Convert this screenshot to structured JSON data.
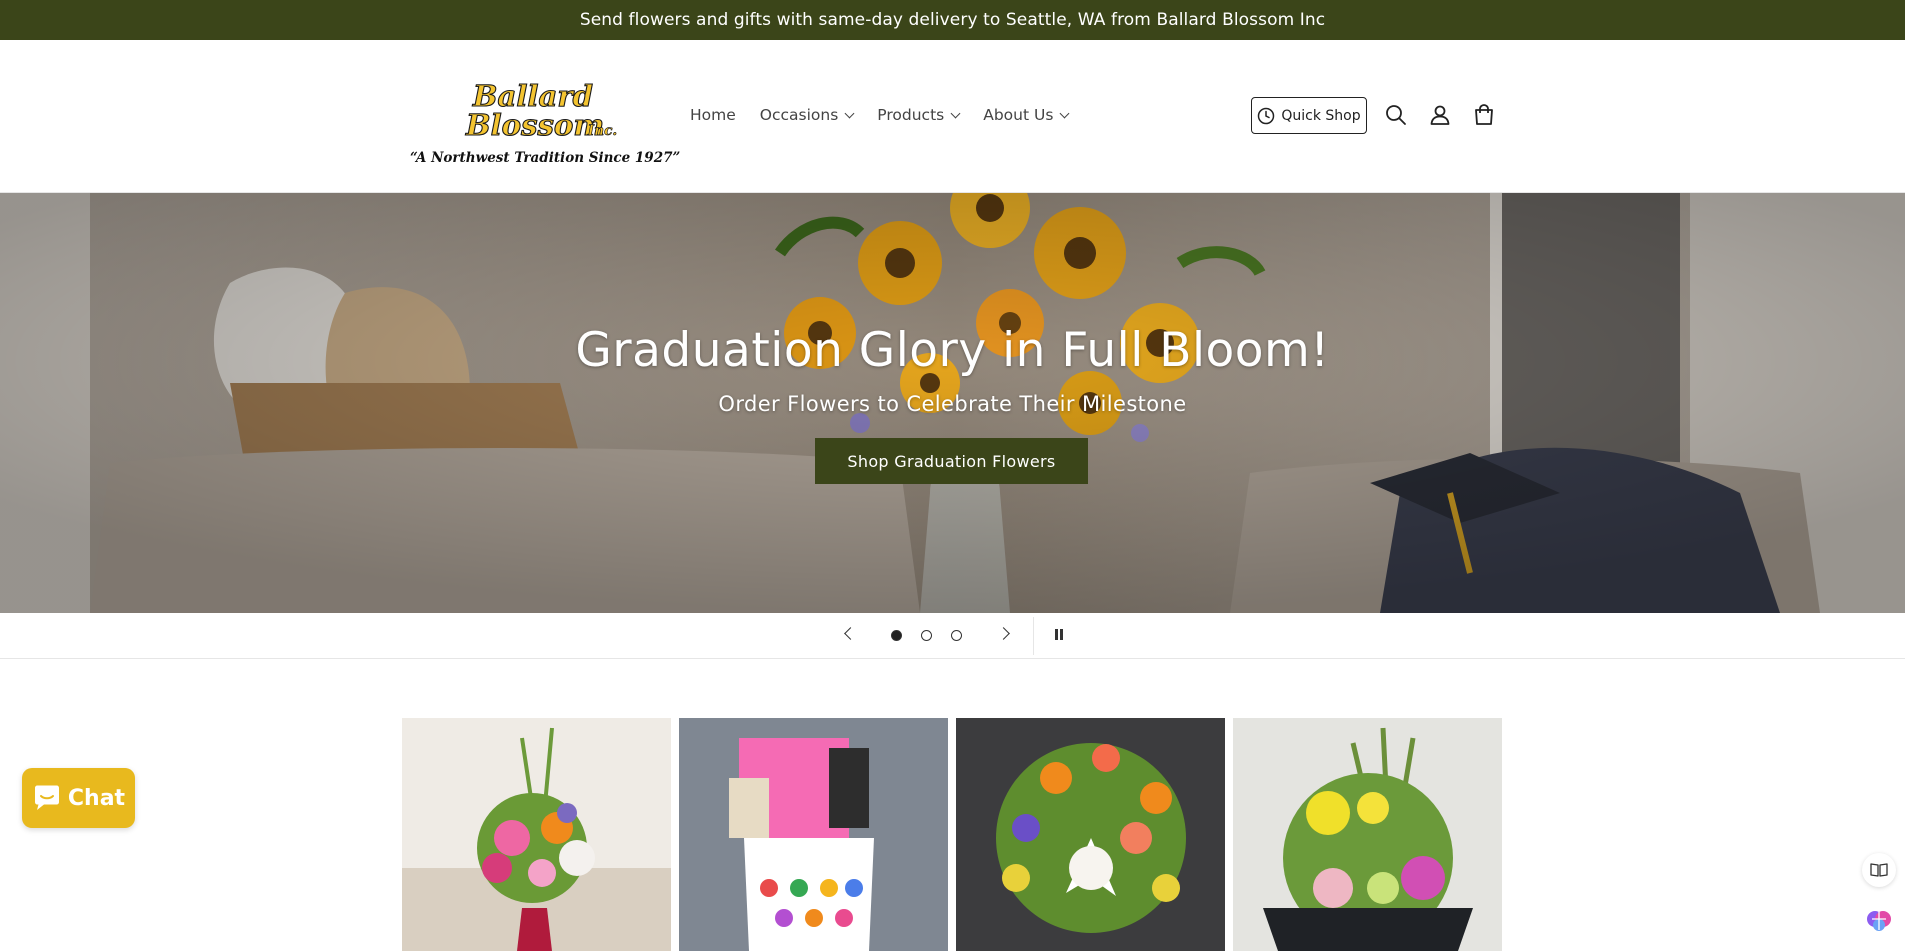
{
  "announcement": "Send flowers and gifts with same-day delivery to Seattle, WA from Ballard Blossom Inc",
  "logo": {
    "line1": "Ballard",
    "line2": "Blossom",
    "suffix": "Inc.",
    "tagline": "“A Northwest Tradition Since 1927”"
  },
  "nav": {
    "items": [
      {
        "label": "Home",
        "has_dropdown": false
      },
      {
        "label": "Occasions",
        "has_dropdown": true
      },
      {
        "label": "Products",
        "has_dropdown": true
      },
      {
        "label": "About Us",
        "has_dropdown": true
      }
    ]
  },
  "header_actions": {
    "quick_shop_label": "Quick Shop",
    "icons": [
      "search-icon",
      "account-icon",
      "cart-icon"
    ]
  },
  "hero": {
    "title": "Graduation Glory in Full Bloom!",
    "subtitle": "Order Flowers to Celebrate Their Milestone",
    "button_label": "Shop Graduation Flowers"
  },
  "slider": {
    "slide_count": 3,
    "active_slide": 1
  },
  "chat": {
    "label": "Chat"
  },
  "colors": {
    "brand_green": "#3b4519",
    "chat_yellow": "#e8b91e",
    "logo_yellow": "#f4c430"
  }
}
